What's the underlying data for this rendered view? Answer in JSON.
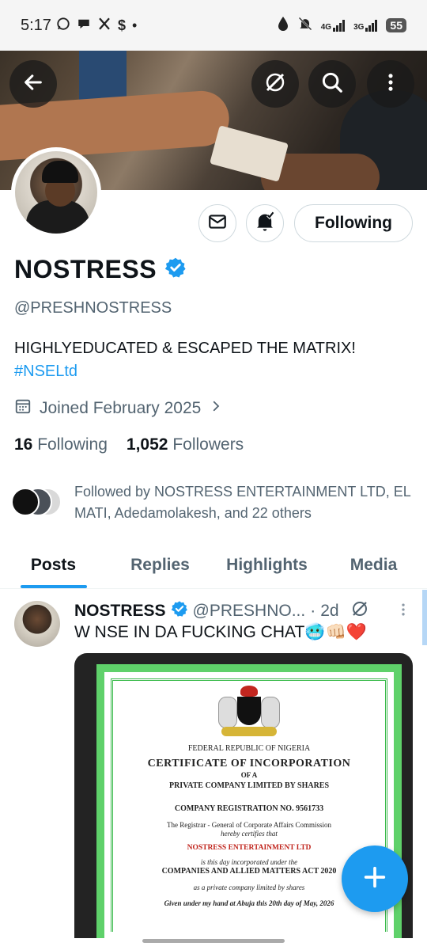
{
  "status_bar": {
    "time": "5:17",
    "icons_left": [
      "whatsapp-icon",
      "chat-icon",
      "x-icon",
      "cashapp-icon",
      "dot-icon"
    ],
    "signal_4g": "4G",
    "signal_3g": "3G",
    "battery": "55"
  },
  "banner": {
    "back_icon": "back-arrow-icon",
    "grok_icon": "grok-icon",
    "search_icon": "search-icon",
    "more_icon": "more-vertical-icon"
  },
  "profile": {
    "display_name": "NOSTRESS",
    "verified": true,
    "handle": "@PRESHNOSTRESS",
    "bio": "HIGHLYEDUCATED & ESCAPED THE MATRIX!",
    "hashtag": "#NSELtd",
    "joined": "Joined February 2025",
    "following_count": "16",
    "following_label": "Following",
    "followers_count": "1,052",
    "followers_label": "Followers",
    "followed_by": "Followed by NOSTRESS ENTERTAINMENT LTD, EL MATI, Adedamolakesh, and 22 others",
    "following_button": "Following"
  },
  "tabs": [
    {
      "label": "Posts",
      "active": true
    },
    {
      "label": "Replies",
      "active": false
    },
    {
      "label": "Highlights",
      "active": false
    },
    {
      "label": "Media",
      "active": false
    }
  ],
  "post": {
    "author": "NOSTRESS",
    "handle": "@PRESHNO...",
    "dot": "·",
    "time": "2d",
    "text": "W NSE IN DA FUCKING CHAT🥶👊🏻❤️",
    "certificate": {
      "line1": "FEDERAL REPUBLIC OF NIGERIA",
      "title": "CERTIFICATE OF INCORPORATION",
      "of_a": "OF A",
      "company_type": "PRIVATE COMPANY LIMITED BY SHARES",
      "reg_no": "COMPANY REGISTRATION NO. 9561733",
      "registrar": "The Registrar - General of Corporate Affairs Commission",
      "certifies": "hereby certifies that",
      "company_name": "NOSTRESS ENTERTAINMENT LTD",
      "incorporated": "is this day incorporated under the",
      "act": "COMPANIES AND ALLIED MATTERS ACT 2020",
      "as_a": "as a private company limited by shares",
      "given": "Given under my hand at Abuja this 20th day of May, 2026"
    }
  },
  "colors": {
    "accent": "#1d9bf0",
    "text_primary": "#0f1419",
    "text_secondary": "#536471",
    "border": "#cfd9de"
  }
}
